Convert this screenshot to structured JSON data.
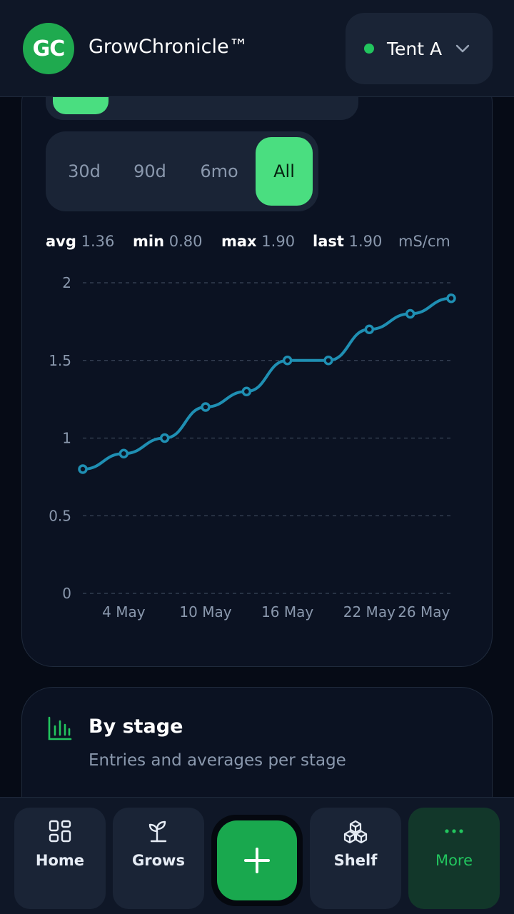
{
  "header": {
    "logo_text": "GC",
    "app_title": "GrowChronicle™",
    "tent_label": "Tent A",
    "tent_status_color": "#22c55e"
  },
  "range_tabs": [
    {
      "label": "30d",
      "active": false
    },
    {
      "label": "90d",
      "active": false
    },
    {
      "label": "6mo",
      "active": false
    },
    {
      "label": "All",
      "active": true
    }
  ],
  "stats": {
    "avg_label": "avg",
    "avg_value": "1.36",
    "min_label": "min",
    "min_value": "0.80",
    "max_label": "max",
    "max_value": "1.90",
    "last_label": "last",
    "last_value": "1.90",
    "unit": "mS/cm"
  },
  "chart_data": {
    "type": "line",
    "x": [
      "1 May",
      "4 May",
      "7 May",
      "10 May",
      "13 May",
      "16 May",
      "19 May",
      "22 May",
      "25 May",
      "28 May"
    ],
    "x_ticks": [
      "4 May",
      "10 May",
      "16 May",
      "22 May",
      "26 May"
    ],
    "y": [
      0.8,
      0.9,
      1.0,
      1.2,
      1.3,
      1.5,
      1.5,
      1.7,
      1.8,
      1.9
    ],
    "y_ticks": [
      "0",
      "0.5",
      "1",
      "1.5",
      "2"
    ],
    "ylim": [
      0,
      2
    ],
    "grid": true,
    "line_color": "#1f8fb3"
  },
  "stage_card": {
    "title": "By stage",
    "subtitle": "Entries and averages per stage"
  },
  "nav": {
    "items": [
      {
        "label": "Home",
        "icon": "grid-icon"
      },
      {
        "label": "Grows",
        "icon": "sprout-icon"
      },
      {
        "label": "Shelf",
        "icon": "boxes-icon"
      },
      {
        "label": "More",
        "icon": "more-dots-icon"
      }
    ],
    "fab_icon": "plus-icon",
    "accent": "#22c55e"
  }
}
